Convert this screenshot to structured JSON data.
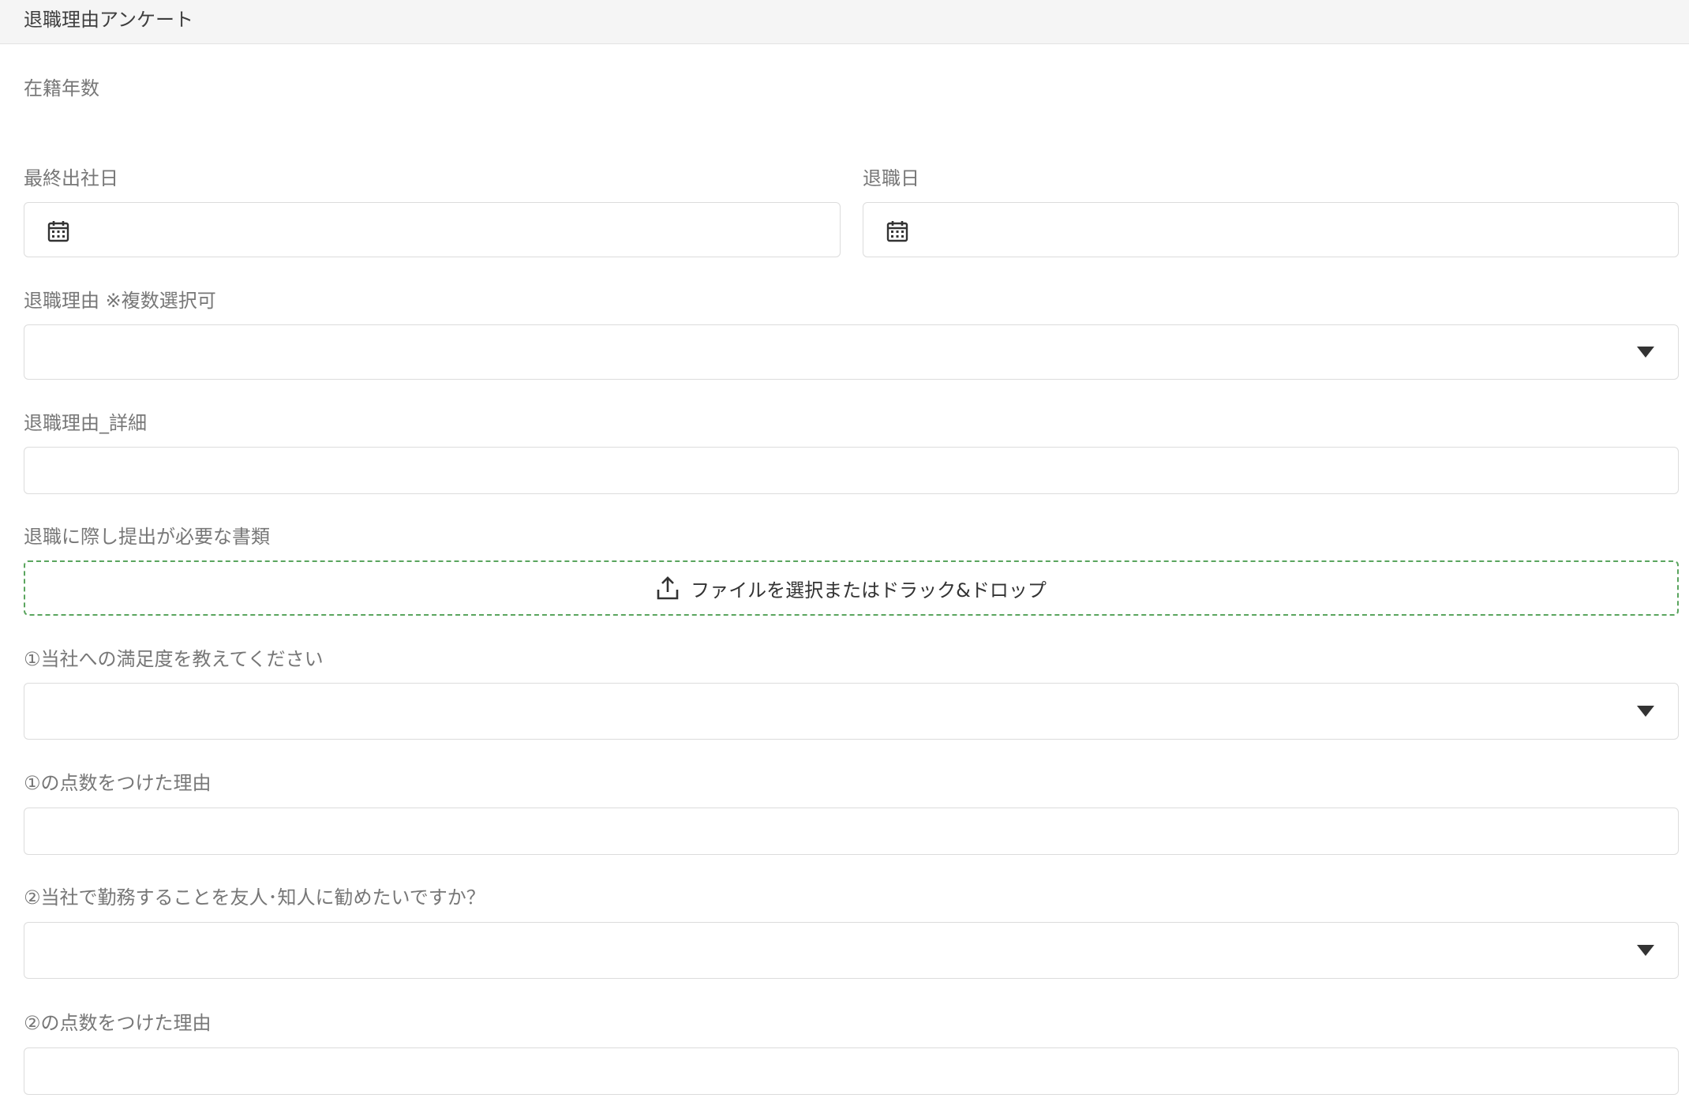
{
  "header": {
    "title": "退職理由アンケート"
  },
  "fields": {
    "tenure_label": "在籍年数",
    "last_work_day_label": "最終出社日",
    "retirement_date_label": "退職日",
    "reason_label": "退職理由 ※複数選択可",
    "reason_detail_label": "退職理由_詳細",
    "documents_label": "退職に際し提出が必要な書類",
    "upload_text": "ファイルを選択またはドラック&ドロップ",
    "q1_label": "①当社への満足度を教えてください",
    "q1_reason_label": "①の点数をつけた理由",
    "q2_label": "②当社で勤務することを友人･知人に勧めたいですか？",
    "q2_reason_label": "②の点数をつけた理由"
  },
  "icons": {
    "calendar": "calendar-icon",
    "dropdown": "chevron-down-icon",
    "upload": "upload-icon"
  },
  "colors": {
    "header_bg": "#f5f5f5",
    "label_text": "#777777",
    "field_border": "#dcdcdc",
    "dropzone_border": "#5aa55e",
    "icon": "#333333"
  }
}
